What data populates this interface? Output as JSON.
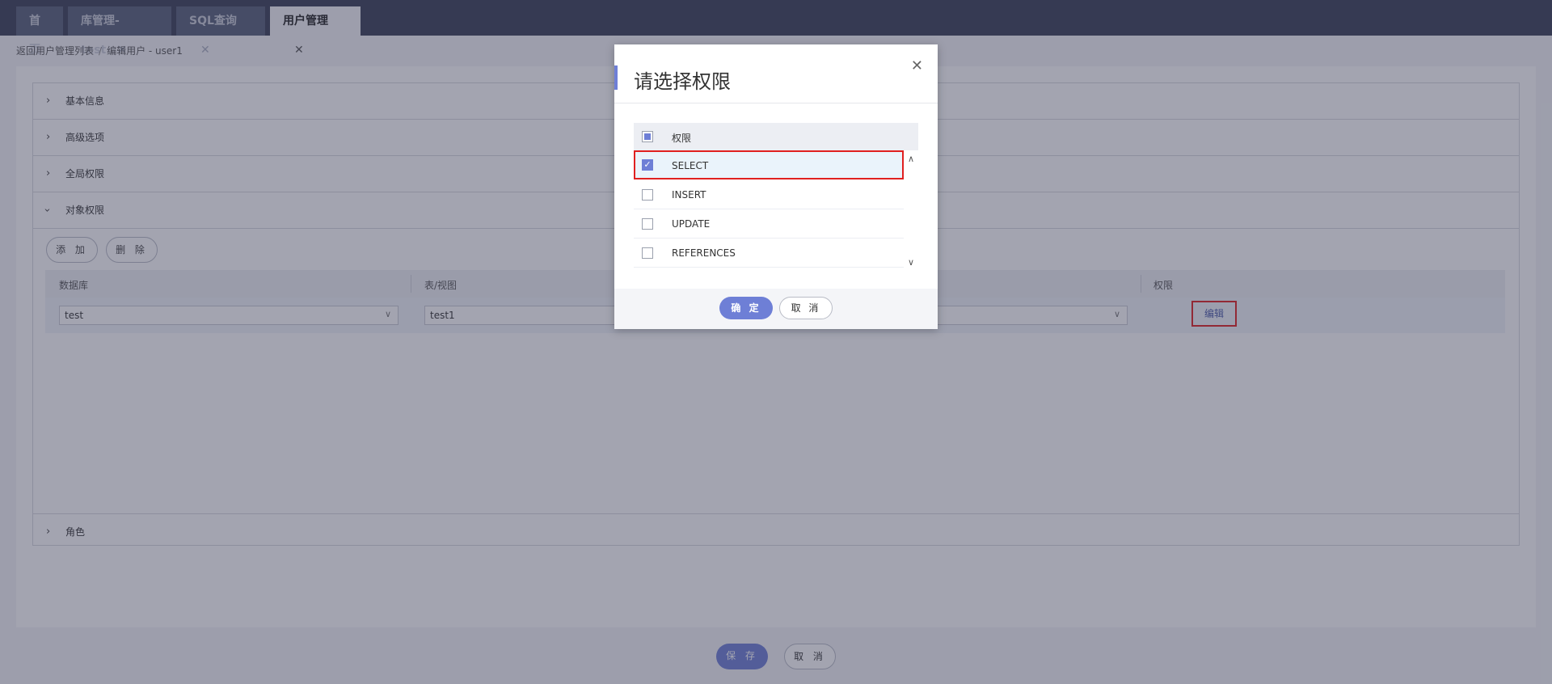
{
  "tabs": [
    {
      "label": "首页",
      "closable": false
    },
    {
      "label": "库管理-test",
      "closable": true
    },
    {
      "label": "SQL查询",
      "closable": true
    },
    {
      "label": "用户管理",
      "closable": true,
      "active": true
    }
  ],
  "close_glyph": "✕",
  "breadcrumb": {
    "back": "返回用户管理列表",
    "separator": "/",
    "current": "编辑用户 - user1"
  },
  "sections": [
    "基本信息",
    "高级选项",
    "全局权限",
    "对象权限",
    "角色"
  ],
  "object_perm": {
    "add_label": "添 加",
    "delete_label": "删 除",
    "columns": [
      "数据库",
      "表/视图",
      "权限"
    ],
    "row": {
      "database": "test",
      "table": "test1",
      "edit_label": "编辑"
    }
  },
  "footer": {
    "save_label": "保 存",
    "cancel_label": "取 消"
  },
  "dialog": {
    "title": "请选择权限",
    "header_label": "权限",
    "options": [
      {
        "label": "SELECT",
        "checked": true
      },
      {
        "label": "INSERT",
        "checked": false
      },
      {
        "label": "UPDATE",
        "checked": false
      },
      {
        "label": "REFERENCES",
        "checked": false
      }
    ],
    "ok_label": "确 定",
    "cancel_label": "取 消"
  },
  "colors": {
    "accent": "#6e7fd6",
    "highlight_border": "#e02020",
    "tabbar": "#3a3e57"
  }
}
